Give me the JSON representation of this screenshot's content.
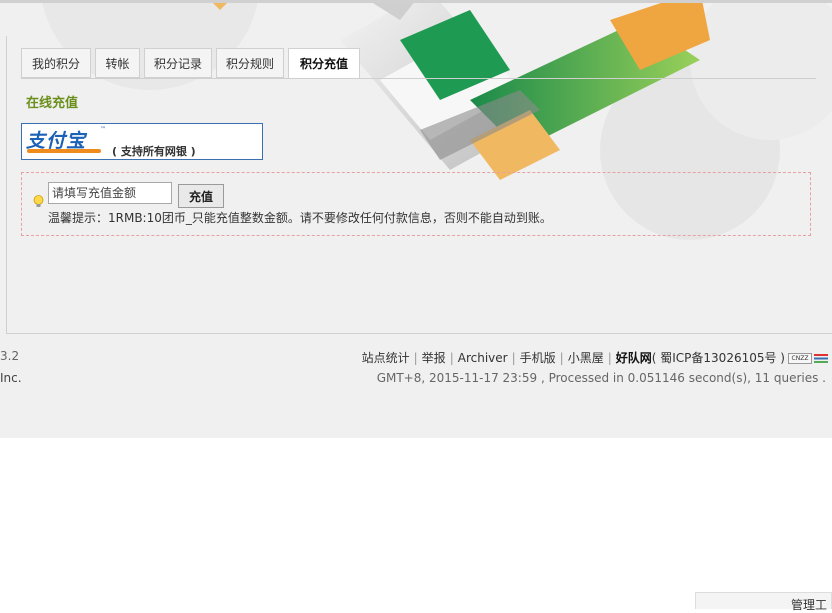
{
  "tabs": [
    {
      "label": "我的积分",
      "active": false
    },
    {
      "label": "转帐",
      "active": false
    },
    {
      "label": "积分记录",
      "active": false
    },
    {
      "label": "积分规则",
      "active": false
    },
    {
      "label": "积分充值",
      "active": true
    }
  ],
  "section_title": "在线充值",
  "alipay": {
    "logo_text": "支付宝",
    "tm": "™",
    "desc": "( 支持所有网银 )"
  },
  "recharge": {
    "input_placeholder": "请填写充值金额",
    "input_value": "",
    "submit_label": "充值",
    "tip": "温馨提示：1RMB:10团币_只能充值整数金额。请不要修改任何付款信息，否则不能自动到账。"
  },
  "footer": {
    "left_line1": "3.2",
    "left_line2": "Inc.",
    "links": [
      "站点统计",
      "举报",
      "Archiver",
      "手机版",
      "小黑屋"
    ],
    "brand": "好队网",
    "icp": "( 蜀ICP备13026105号 )",
    "cnzz": "CNZZ",
    "time_info": "GMT+8, 2015-11-17 23:59 , Processed in 0.051146 second(s), 11 queries ."
  },
  "manage_label": "管理工",
  "colors": {
    "accent_green": "#6a8f1a",
    "alipay_blue": "#1b61b6",
    "alipay_orange": "#f08c1e",
    "tip_border": "#e8a0a0"
  }
}
